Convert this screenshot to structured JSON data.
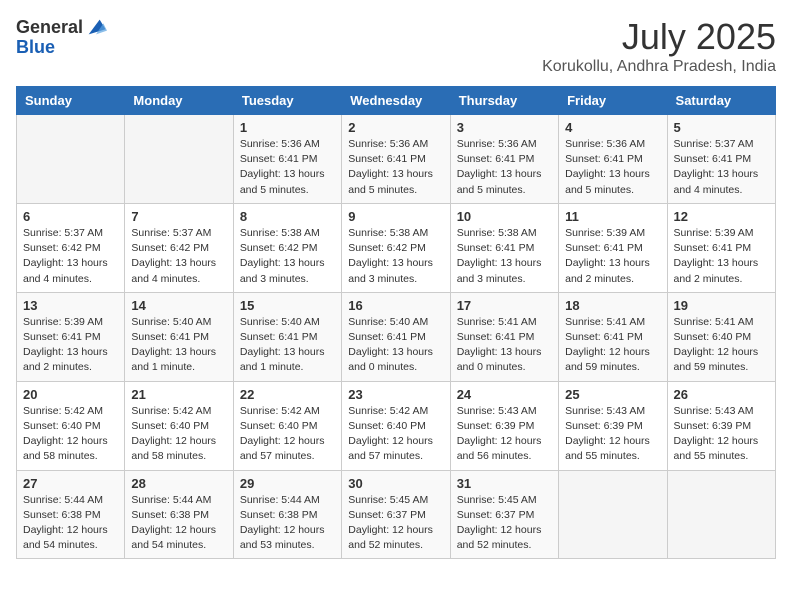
{
  "header": {
    "logo_general": "General",
    "logo_blue": "Blue",
    "month_year": "July 2025",
    "location": "Korukollu, Andhra Pradesh, India"
  },
  "weekdays": [
    "Sunday",
    "Monday",
    "Tuesday",
    "Wednesday",
    "Thursday",
    "Friday",
    "Saturday"
  ],
  "weeks": [
    [
      {
        "day": "",
        "info": ""
      },
      {
        "day": "",
        "info": ""
      },
      {
        "day": "1",
        "info": "Sunrise: 5:36 AM\nSunset: 6:41 PM\nDaylight: 13 hours and 5 minutes."
      },
      {
        "day": "2",
        "info": "Sunrise: 5:36 AM\nSunset: 6:41 PM\nDaylight: 13 hours and 5 minutes."
      },
      {
        "day": "3",
        "info": "Sunrise: 5:36 AM\nSunset: 6:41 PM\nDaylight: 13 hours and 5 minutes."
      },
      {
        "day": "4",
        "info": "Sunrise: 5:36 AM\nSunset: 6:41 PM\nDaylight: 13 hours and 5 minutes."
      },
      {
        "day": "5",
        "info": "Sunrise: 5:37 AM\nSunset: 6:41 PM\nDaylight: 13 hours and 4 minutes."
      }
    ],
    [
      {
        "day": "6",
        "info": "Sunrise: 5:37 AM\nSunset: 6:42 PM\nDaylight: 13 hours and 4 minutes."
      },
      {
        "day": "7",
        "info": "Sunrise: 5:37 AM\nSunset: 6:42 PM\nDaylight: 13 hours and 4 minutes."
      },
      {
        "day": "8",
        "info": "Sunrise: 5:38 AM\nSunset: 6:42 PM\nDaylight: 13 hours and 3 minutes."
      },
      {
        "day": "9",
        "info": "Sunrise: 5:38 AM\nSunset: 6:42 PM\nDaylight: 13 hours and 3 minutes."
      },
      {
        "day": "10",
        "info": "Sunrise: 5:38 AM\nSunset: 6:41 PM\nDaylight: 13 hours and 3 minutes."
      },
      {
        "day": "11",
        "info": "Sunrise: 5:39 AM\nSunset: 6:41 PM\nDaylight: 13 hours and 2 minutes."
      },
      {
        "day": "12",
        "info": "Sunrise: 5:39 AM\nSunset: 6:41 PM\nDaylight: 13 hours and 2 minutes."
      }
    ],
    [
      {
        "day": "13",
        "info": "Sunrise: 5:39 AM\nSunset: 6:41 PM\nDaylight: 13 hours and 2 minutes."
      },
      {
        "day": "14",
        "info": "Sunrise: 5:40 AM\nSunset: 6:41 PM\nDaylight: 13 hours and 1 minute."
      },
      {
        "day": "15",
        "info": "Sunrise: 5:40 AM\nSunset: 6:41 PM\nDaylight: 13 hours and 1 minute."
      },
      {
        "day": "16",
        "info": "Sunrise: 5:40 AM\nSunset: 6:41 PM\nDaylight: 13 hours and 0 minutes."
      },
      {
        "day": "17",
        "info": "Sunrise: 5:41 AM\nSunset: 6:41 PM\nDaylight: 13 hours and 0 minutes."
      },
      {
        "day": "18",
        "info": "Sunrise: 5:41 AM\nSunset: 6:41 PM\nDaylight: 12 hours and 59 minutes."
      },
      {
        "day": "19",
        "info": "Sunrise: 5:41 AM\nSunset: 6:40 PM\nDaylight: 12 hours and 59 minutes."
      }
    ],
    [
      {
        "day": "20",
        "info": "Sunrise: 5:42 AM\nSunset: 6:40 PM\nDaylight: 12 hours and 58 minutes."
      },
      {
        "day": "21",
        "info": "Sunrise: 5:42 AM\nSunset: 6:40 PM\nDaylight: 12 hours and 58 minutes."
      },
      {
        "day": "22",
        "info": "Sunrise: 5:42 AM\nSunset: 6:40 PM\nDaylight: 12 hours and 57 minutes."
      },
      {
        "day": "23",
        "info": "Sunrise: 5:42 AM\nSunset: 6:40 PM\nDaylight: 12 hours and 57 minutes."
      },
      {
        "day": "24",
        "info": "Sunrise: 5:43 AM\nSunset: 6:39 PM\nDaylight: 12 hours and 56 minutes."
      },
      {
        "day": "25",
        "info": "Sunrise: 5:43 AM\nSunset: 6:39 PM\nDaylight: 12 hours and 55 minutes."
      },
      {
        "day": "26",
        "info": "Sunrise: 5:43 AM\nSunset: 6:39 PM\nDaylight: 12 hours and 55 minutes."
      }
    ],
    [
      {
        "day": "27",
        "info": "Sunrise: 5:44 AM\nSunset: 6:38 PM\nDaylight: 12 hours and 54 minutes."
      },
      {
        "day": "28",
        "info": "Sunrise: 5:44 AM\nSunset: 6:38 PM\nDaylight: 12 hours and 54 minutes."
      },
      {
        "day": "29",
        "info": "Sunrise: 5:44 AM\nSunset: 6:38 PM\nDaylight: 12 hours and 53 minutes."
      },
      {
        "day": "30",
        "info": "Sunrise: 5:45 AM\nSunset: 6:37 PM\nDaylight: 12 hours and 52 minutes."
      },
      {
        "day": "31",
        "info": "Sunrise: 5:45 AM\nSunset: 6:37 PM\nDaylight: 12 hours and 52 minutes."
      },
      {
        "day": "",
        "info": ""
      },
      {
        "day": "",
        "info": ""
      }
    ]
  ]
}
